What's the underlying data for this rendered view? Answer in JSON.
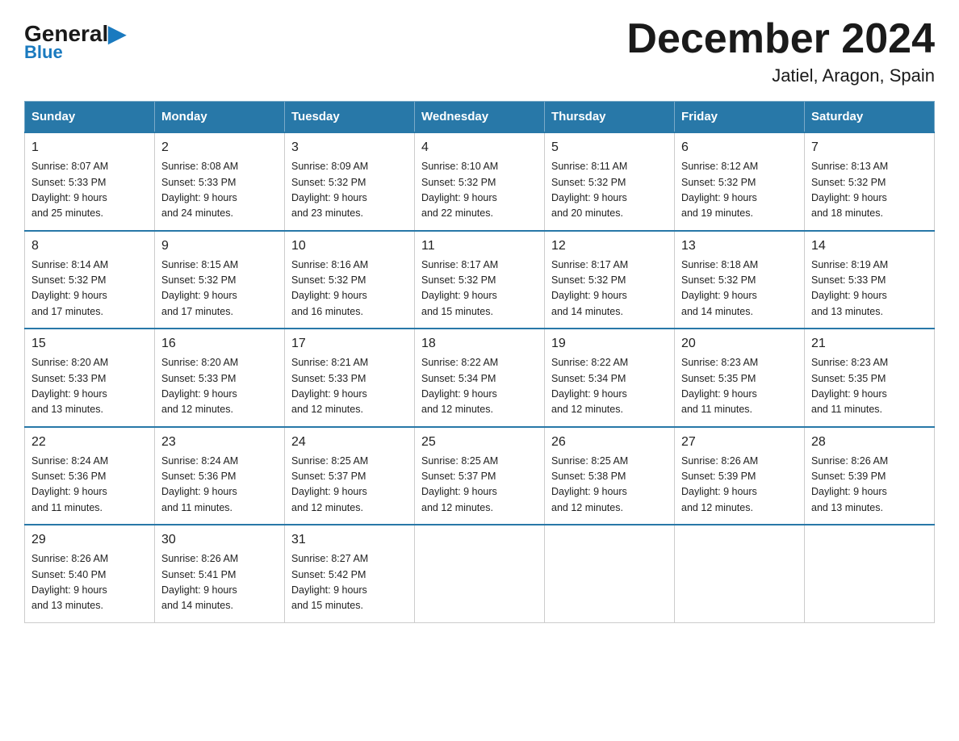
{
  "logo": {
    "general": "General",
    "blue": "Blue",
    "arrow": "▶"
  },
  "title": "December 2024",
  "subtitle": "Jatiel, Aragon, Spain",
  "days_header": [
    "Sunday",
    "Monday",
    "Tuesday",
    "Wednesday",
    "Thursday",
    "Friday",
    "Saturday"
  ],
  "weeks": [
    [
      {
        "num": "1",
        "sunrise": "8:07 AM",
        "sunset": "5:33 PM",
        "daylight": "9 hours and 25 minutes."
      },
      {
        "num": "2",
        "sunrise": "8:08 AM",
        "sunset": "5:33 PM",
        "daylight": "9 hours and 24 minutes."
      },
      {
        "num": "3",
        "sunrise": "8:09 AM",
        "sunset": "5:32 PM",
        "daylight": "9 hours and 23 minutes."
      },
      {
        "num": "4",
        "sunrise": "8:10 AM",
        "sunset": "5:32 PM",
        "daylight": "9 hours and 22 minutes."
      },
      {
        "num": "5",
        "sunrise": "8:11 AM",
        "sunset": "5:32 PM",
        "daylight": "9 hours and 20 minutes."
      },
      {
        "num": "6",
        "sunrise": "8:12 AM",
        "sunset": "5:32 PM",
        "daylight": "9 hours and 19 minutes."
      },
      {
        "num": "7",
        "sunrise": "8:13 AM",
        "sunset": "5:32 PM",
        "daylight": "9 hours and 18 minutes."
      }
    ],
    [
      {
        "num": "8",
        "sunrise": "8:14 AM",
        "sunset": "5:32 PM",
        "daylight": "9 hours and 17 minutes."
      },
      {
        "num": "9",
        "sunrise": "8:15 AM",
        "sunset": "5:32 PM",
        "daylight": "9 hours and 17 minutes."
      },
      {
        "num": "10",
        "sunrise": "8:16 AM",
        "sunset": "5:32 PM",
        "daylight": "9 hours and 16 minutes."
      },
      {
        "num": "11",
        "sunrise": "8:17 AM",
        "sunset": "5:32 PM",
        "daylight": "9 hours and 15 minutes."
      },
      {
        "num": "12",
        "sunrise": "8:17 AM",
        "sunset": "5:32 PM",
        "daylight": "9 hours and 14 minutes."
      },
      {
        "num": "13",
        "sunrise": "8:18 AM",
        "sunset": "5:32 PM",
        "daylight": "9 hours and 14 minutes."
      },
      {
        "num": "14",
        "sunrise": "8:19 AM",
        "sunset": "5:33 PM",
        "daylight": "9 hours and 13 minutes."
      }
    ],
    [
      {
        "num": "15",
        "sunrise": "8:20 AM",
        "sunset": "5:33 PM",
        "daylight": "9 hours and 13 minutes."
      },
      {
        "num": "16",
        "sunrise": "8:20 AM",
        "sunset": "5:33 PM",
        "daylight": "9 hours and 12 minutes."
      },
      {
        "num": "17",
        "sunrise": "8:21 AM",
        "sunset": "5:33 PM",
        "daylight": "9 hours and 12 minutes."
      },
      {
        "num": "18",
        "sunrise": "8:22 AM",
        "sunset": "5:34 PM",
        "daylight": "9 hours and 12 minutes."
      },
      {
        "num": "19",
        "sunrise": "8:22 AM",
        "sunset": "5:34 PM",
        "daylight": "9 hours and 12 minutes."
      },
      {
        "num": "20",
        "sunrise": "8:23 AM",
        "sunset": "5:35 PM",
        "daylight": "9 hours and 11 minutes."
      },
      {
        "num": "21",
        "sunrise": "8:23 AM",
        "sunset": "5:35 PM",
        "daylight": "9 hours and 11 minutes."
      }
    ],
    [
      {
        "num": "22",
        "sunrise": "8:24 AM",
        "sunset": "5:36 PM",
        "daylight": "9 hours and 11 minutes."
      },
      {
        "num": "23",
        "sunrise": "8:24 AM",
        "sunset": "5:36 PM",
        "daylight": "9 hours and 11 minutes."
      },
      {
        "num": "24",
        "sunrise": "8:25 AM",
        "sunset": "5:37 PM",
        "daylight": "9 hours and 12 minutes."
      },
      {
        "num": "25",
        "sunrise": "8:25 AM",
        "sunset": "5:37 PM",
        "daylight": "9 hours and 12 minutes."
      },
      {
        "num": "26",
        "sunrise": "8:25 AM",
        "sunset": "5:38 PM",
        "daylight": "9 hours and 12 minutes."
      },
      {
        "num": "27",
        "sunrise": "8:26 AM",
        "sunset": "5:39 PM",
        "daylight": "9 hours and 12 minutes."
      },
      {
        "num": "28",
        "sunrise": "8:26 AM",
        "sunset": "5:39 PM",
        "daylight": "9 hours and 13 minutes."
      }
    ],
    [
      {
        "num": "29",
        "sunrise": "8:26 AM",
        "sunset": "5:40 PM",
        "daylight": "9 hours and 13 minutes."
      },
      {
        "num": "30",
        "sunrise": "8:26 AM",
        "sunset": "5:41 PM",
        "daylight": "9 hours and 14 minutes."
      },
      {
        "num": "31",
        "sunrise": "8:27 AM",
        "sunset": "5:42 PM",
        "daylight": "9 hours and 15 minutes."
      },
      null,
      null,
      null,
      null
    ]
  ],
  "labels": {
    "sunrise": "Sunrise:",
    "sunset": "Sunset:",
    "daylight": "Daylight:"
  }
}
